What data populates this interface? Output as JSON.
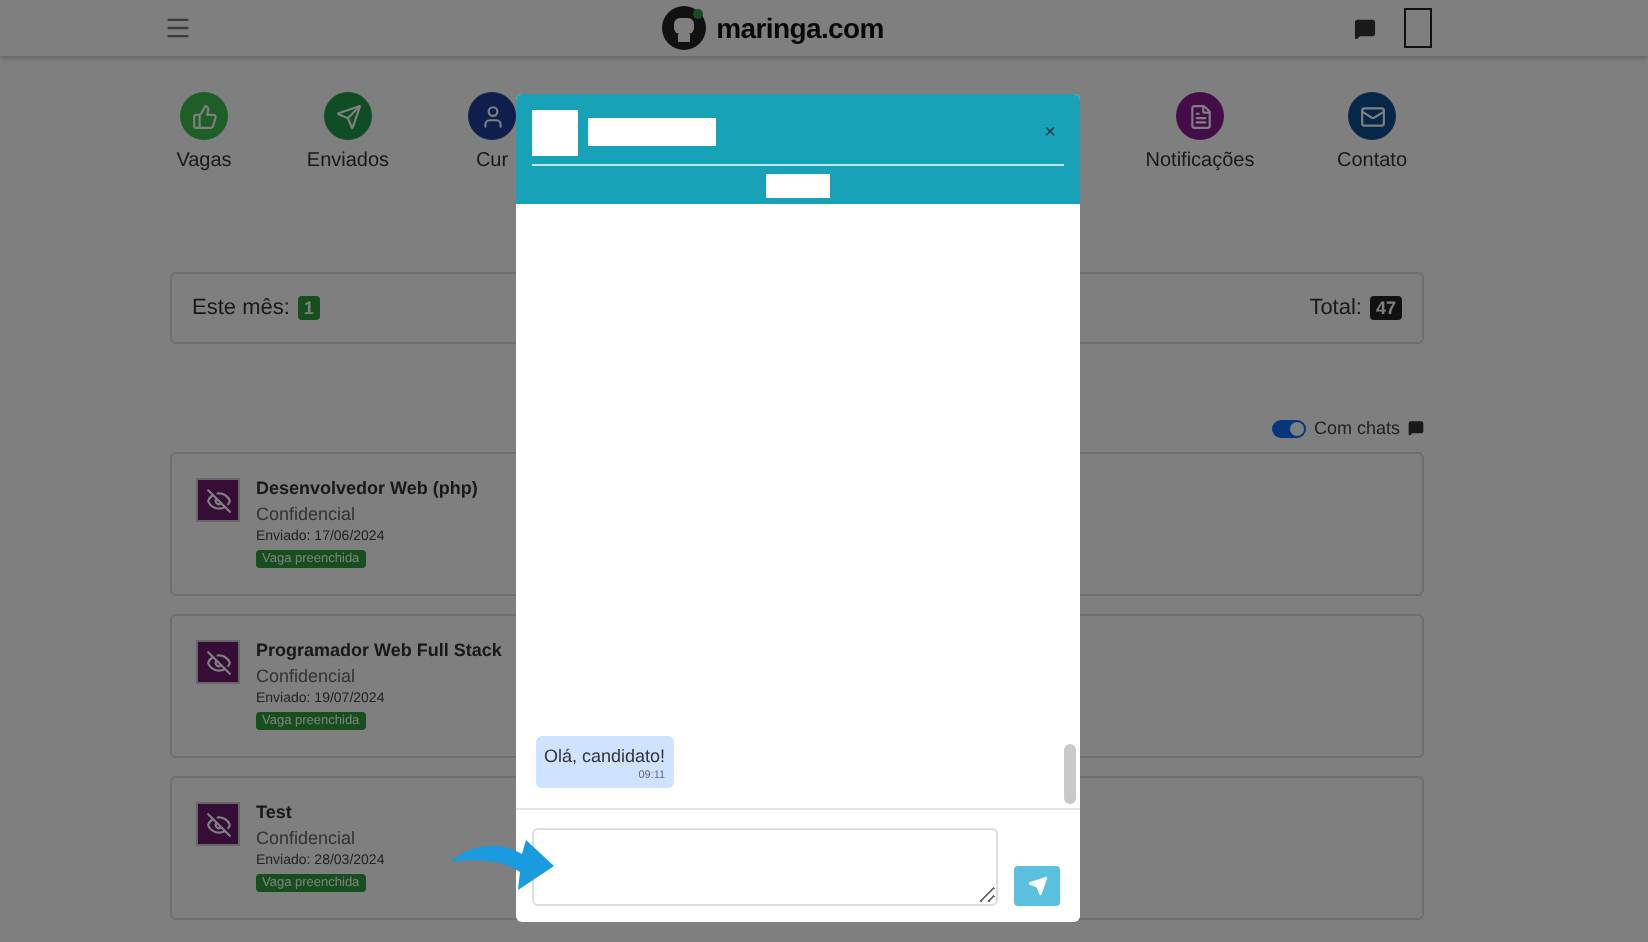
{
  "header": {
    "logo": "maringa.com"
  },
  "nav": {
    "left": [
      {
        "label": "Vagas",
        "kind": "thumbs"
      },
      {
        "label": "Enviados",
        "kind": "send"
      },
      {
        "label": "Cur",
        "kind": "profile"
      }
    ],
    "right": [
      {
        "label": "Notificações",
        "kind": "notes"
      },
      {
        "label": "Contato",
        "kind": "mail"
      }
    ]
  },
  "stats": {
    "month_label": "Este mês:",
    "month_count": "1",
    "total_label": "Total:",
    "total_count": "47"
  },
  "filter": {
    "label": "Com chats",
    "on": true
  },
  "applications": [
    {
      "title": "Desenvolvedor Web (php)",
      "company": "Confidencial",
      "sent": "Enviado: 17/06/2024",
      "status": "Vaga preenchida"
    },
    {
      "title": "Programador Web Full Stack",
      "company": "Confidencial",
      "sent": "Enviado: 19/07/2024",
      "status": "Vaga preenchida"
    },
    {
      "title": "Test",
      "company": "Confidencial",
      "sent": "Enviado: 28/03/2024",
      "status": "Vaga preenchida"
    }
  ],
  "chat": {
    "close": "×",
    "messages": [
      {
        "text": "Olá, candidato!",
        "time": "09:11"
      }
    ]
  }
}
